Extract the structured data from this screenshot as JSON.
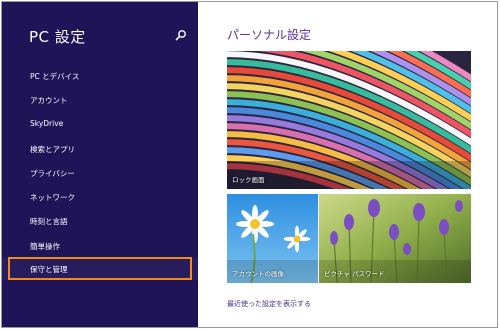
{
  "sidebar": {
    "title": "PC 設定",
    "search_icon": "search-icon",
    "items": [
      {
        "id": "pc-devices",
        "label": "PC とデバイス"
      },
      {
        "id": "account",
        "label": "アカウント"
      },
      {
        "id": "skydrive",
        "label": "SkyDrive"
      },
      {
        "id": "search-apps",
        "label": "検索とアプリ"
      },
      {
        "id": "privacy",
        "label": "プライバシー"
      },
      {
        "id": "network",
        "label": "ネットワーク"
      },
      {
        "id": "time-language",
        "label": "時刻と言語"
      },
      {
        "id": "ease-of-access",
        "label": "簡単操作"
      },
      {
        "id": "update-recovery",
        "label": "保守と管理"
      }
    ],
    "highlighted_item": "保守と管理"
  },
  "main": {
    "title": "パーソナル設定",
    "tiles": {
      "lock_screen": "ロック画面",
      "account_picture": "アカウントの画像",
      "picture_password": "ピクチャ パスワード"
    },
    "recent_link": "最近使った設定を表示する"
  },
  "colors": {
    "sidebar_bg": "#1f1457",
    "accent_title": "#5a2fa1",
    "highlight": "#f08a1c"
  }
}
